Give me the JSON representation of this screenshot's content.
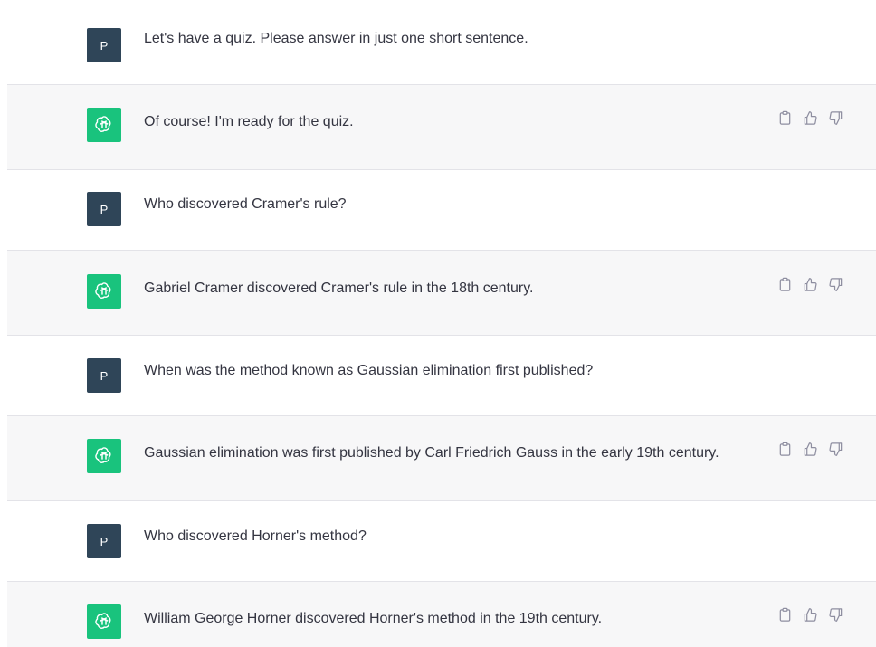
{
  "conversation": {
    "messages": [
      {
        "role": "user",
        "avatar": "P",
        "text": "Let's have a quiz. Please answer in just one short sentence."
      },
      {
        "role": "assistant",
        "avatar_icon": "openai-logo-icon",
        "text": "Of course! I'm ready for the quiz."
      },
      {
        "role": "user",
        "avatar": "P",
        "text": "Who discovered Cramer's rule?"
      },
      {
        "role": "assistant",
        "avatar_icon": "openai-logo-icon",
        "text": "Gabriel Cramer discovered Cramer's rule in the 18th century."
      },
      {
        "role": "user",
        "avatar": "P",
        "text": "When was the method known as Gaussian elimination first published?"
      },
      {
        "role": "assistant",
        "avatar_icon": "openai-logo-icon",
        "text": "Gaussian elimination was first published by Carl Friedrich Gauss in the early 19th century."
      },
      {
        "role": "user",
        "avatar": "P",
        "text": "Who discovered Horner's method?"
      },
      {
        "role": "assistant",
        "avatar_icon": "openai-logo-icon",
        "text": "William George Horner discovered Horner's method in the 19th century."
      }
    ],
    "assistant_actions": [
      "clipboard-icon",
      "thumbs-up-icon",
      "thumbs-down-icon"
    ]
  },
  "colors": {
    "user_bg": "#ffffff",
    "assistant_bg": "#f7f7f8",
    "user_avatar": "#2f4558",
    "assistant_avatar": "#19c37d",
    "text": "#343541",
    "icon": "#8e8ea0"
  }
}
